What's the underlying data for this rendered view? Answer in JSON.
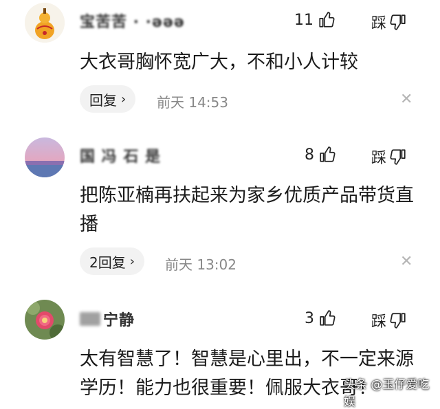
{
  "comments": [
    {
      "username": "宝苦苦 · ·ǝǝǝ",
      "likes": "11",
      "dislike_label": "踩",
      "content": "大衣哥胸怀宽广大，不和小人计较",
      "reply_label": "回复",
      "time": "前天  14:53",
      "close": "✕"
    },
    {
      "username": "国   冯 石 是",
      "likes": "8",
      "dislike_label": "踩",
      "content": "把陈亚楠再扶起来为家乡优质产品带货直播",
      "reply_label": "2回复",
      "time": "前天  13:02",
      "close": "✕"
    },
    {
      "username": "宁静",
      "likes": "3",
      "dislike_label": "踩",
      "content": "太有智慧了！智慧是心里出，不一定来源学历！能力也很重要！佩服大衣哥！",
      "reply_label": "",
      "time": "",
      "close": ""
    }
  ],
  "watermark": "头条 @玉仔爱吃娱",
  "colors": {
    "text": "#222222",
    "muted": "#888888",
    "reply_bg": "#f2f2f2"
  }
}
